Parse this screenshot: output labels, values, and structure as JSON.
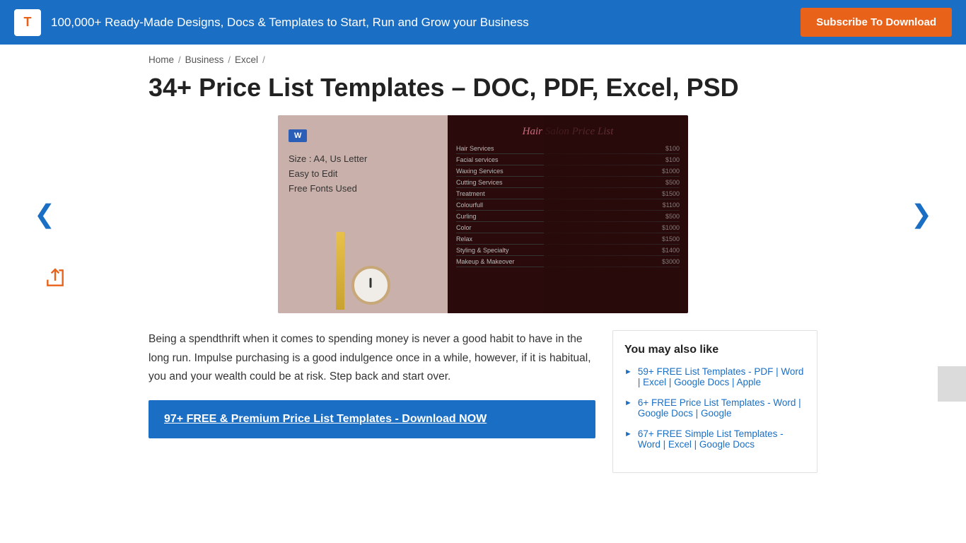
{
  "banner": {
    "logo_text": "T",
    "tagline": "100,000+ Ready-Made Designs, Docs & Templates to Start, Run and Grow your Business",
    "subscribe_label": "Subscribe To Download"
  },
  "breadcrumb": {
    "items": [
      "Home",
      "Business",
      "Excel",
      ""
    ]
  },
  "page": {
    "title": "34+ Price List Templates – DOC, PDF, Excel, PSD"
  },
  "image_panel": {
    "word_badge": "W",
    "left_lines": [
      "Size : A4, Us Letter",
      "Easy to Edit",
      "Free Fonts Used"
    ],
    "salon_title": "Hair Salon Price List",
    "price_items": [
      {
        "name": "Hair Services",
        "price": "$100"
      },
      {
        "name": "Facial services",
        "price": "$100"
      },
      {
        "name": "Waxing Services",
        "price": "$1000"
      },
      {
        "name": "Cutting Services",
        "price": "$500"
      },
      {
        "name": "Treatment",
        "price": "$1500"
      },
      {
        "name": "Colourfull",
        "price": "$1100"
      },
      {
        "name": "Curling",
        "price": "$500"
      },
      {
        "name": "Color",
        "price": "$1000"
      },
      {
        "name": "Relax",
        "price": "$1500"
      },
      {
        "name": "Styling & Specialty",
        "price": "$1400"
      },
      {
        "name": "Makeup & Makeover",
        "price": "$3000"
      }
    ]
  },
  "description": "Being a spendthrift when it comes to spending money is never a good habit to have in the long run. Impulse purchasing is a good indulgence once in a while, however, if it is habitual, you and your wealth could be at risk. Step back and start over.",
  "cta": {
    "label": "97+ FREE & Premium Price List Templates - Download NOW"
  },
  "sidebar": {
    "title": "You may also like",
    "links": [
      "59+ FREE List Templates - PDF | Word | Excel | Google Docs | Apple",
      "6+ FREE Price List Templates - Word | Google Docs | Google",
      "67+ FREE Simple List Templates - Word | Excel | Google Docs"
    ]
  },
  "nav": {
    "prev_label": "❮",
    "next_label": "❯"
  }
}
